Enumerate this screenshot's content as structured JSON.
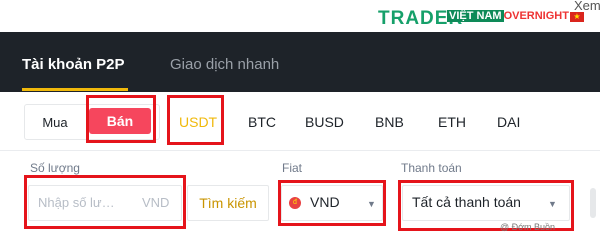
{
  "banner": {
    "logo_text": "TRADER",
    "overlay_vn": "VIỆT NAM",
    "overlay_rest": "OVERNIGHT",
    "partial_link": "Xem"
  },
  "tabs": [
    {
      "label": "Tài khoản P2P",
      "active": true
    },
    {
      "label": "Giao dịch nhanh",
      "active": false
    }
  ],
  "trade_toggle": {
    "buy_label": "Mua",
    "sell_label": "Bán",
    "selected": "Bán"
  },
  "assets": [
    {
      "label": "USDT",
      "active": true
    },
    {
      "label": "BTC",
      "active": false
    },
    {
      "label": "BUSD",
      "active": false
    },
    {
      "label": "BNB",
      "active": false
    },
    {
      "label": "ETH",
      "active": false
    },
    {
      "label": "DAI",
      "active": false
    }
  ],
  "amount": {
    "label": "Số lượng",
    "placeholder": "Nhập số lư…",
    "unit": "VND"
  },
  "search_button": "Tìm kiếm",
  "fiat": {
    "label": "Fiat",
    "value": "VND",
    "icon": "vietnam-dong-icon"
  },
  "payment": {
    "label": "Thanh toán",
    "value": "Tất cả thanh toán"
  },
  "watermark": "@ Đớm Buồn",
  "colors": {
    "header_bg": "#1e2329",
    "accent": "#f0b90b",
    "sell": "#f6465d",
    "highlight": "#e5141b"
  }
}
